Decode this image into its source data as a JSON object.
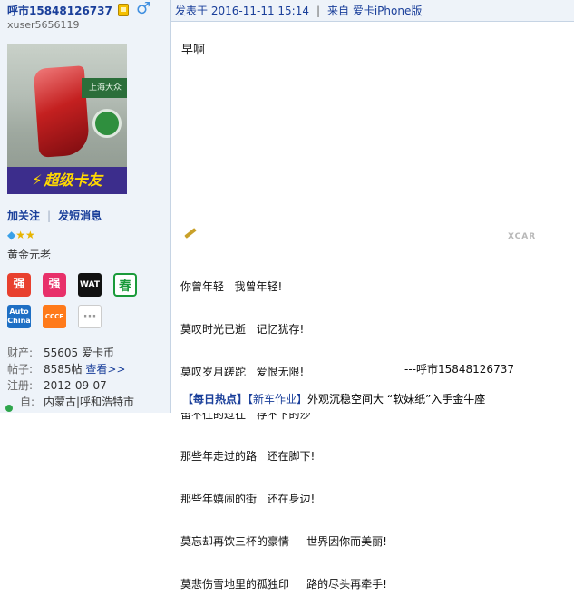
{
  "user": {
    "name": "呼市15848126737",
    "uid": "xuser5656119",
    "avatar_banner": "超级卡友",
    "avatar_plate": "上海大众",
    "follow_label": "加关注",
    "message_label": "发短消息",
    "rank_title": "黄金元老",
    "medals": [
      "强",
      "强",
      "WAT",
      "春",
      "Auto China",
      "CCCF",
      "···"
    ]
  },
  "stats": {
    "wealth_key": "财产:",
    "wealth_val": "55605 爱卡币",
    "posts_key": "帖子:",
    "posts_val": "8585帖",
    "posts_view": "查看>>",
    "reg_key": "注册:",
    "reg_val": "2012-09-07",
    "from_key": "自:",
    "from_val": "内蒙古|呼和浩特市"
  },
  "post": {
    "posted_prefix": "发表于",
    "date": "2016-11-11 15:14",
    "source": "来自 爱卡iPhone版",
    "body": "早啊"
  },
  "signature": {
    "watermark": "XCAR",
    "lines": [
      "你曾年轻   我曾年轻!",
      "莫叹时光已逝   记忆犹存!",
      "莫叹岁月蹉跎   爱恨无限!",
      "留不住的过往   存不下的沙ˇ",
      "那些年走过的路   还在脚下!",
      "那些年嬉闹的街   还在身边!",
      "莫忘却再饮三杯的豪情     世界因你而美丽!",
      "莫悲伤雪地里的孤独印     路的尽头再牵手!"
    ],
    "author": "---呼市15848126737"
  },
  "hot": {
    "tag": "【每日热点】",
    "category": "【新车作业】",
    "text": "外观沉稳空间大 “软妹纸”入手金牛座"
  },
  "colors": {
    "link": "#1a3f9a",
    "panel": "#eef3f9"
  }
}
